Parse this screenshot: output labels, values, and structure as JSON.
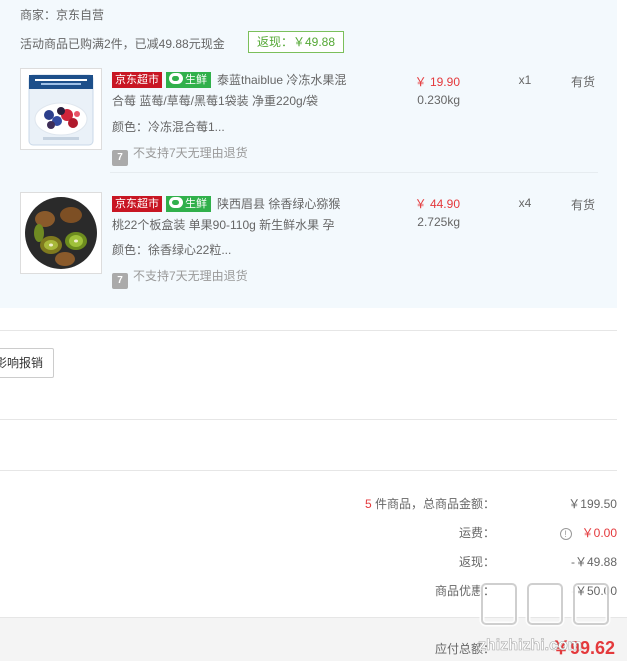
{
  "order": {
    "seller": "商家：京东自营",
    "promo_text": "活动商品已购满2件，已减49.88元现金",
    "rebate_tag": "返现：￥49.88"
  },
  "items": [
    {
      "badge_jd": "京东超市",
      "badge_fresh": "生鲜",
      "title": "泰蓝thaiblue 冷冻水果混合莓 蓝莓/草莓/黑莓1袋装 净重220g/袋",
      "color": "颜色：冷冻混合莓1...",
      "return_policy": "不支持7天无理由退货",
      "return_icon": "7",
      "price": "￥ 19.90",
      "weight": "0.230kg",
      "qty": "x1",
      "stock": "有货"
    },
    {
      "badge_jd": "京东超市",
      "badge_fresh": "生鲜",
      "title": "陕西眉县 徐香绿心猕猴桃22个板盒装 单果90-110g 新生鲜水果 孕",
      "color": "颜色：徐香绿心22粒...",
      "return_policy": "不支持7天无理由退货",
      "return_icon": "7",
      "price": "￥ 44.90",
      "weight": "2.725kg",
      "qty": "x4",
      "stock": "有货"
    }
  ],
  "side_button": "影响报销",
  "summary": {
    "count": "5",
    "count_label": "件商品，总商品金额：",
    "goods_total": "￥199.50",
    "shipping_label": "运费：",
    "shipping_value": "￥0.00",
    "rebate_label": "返现：",
    "rebate_value": "-￥49.88",
    "discount_label": "商品优惠：",
    "discount_value": "-￥50.00",
    "total_label": "应付总额：",
    "total_value": "￥99.62"
  },
  "watermark": {
    "text": "zhizhizhi.com"
  },
  "colors": {
    "accent_red": "#e4393c",
    "jd_red": "#c81623",
    "fresh_green": "#30b04b",
    "rebate_green": "#54a835",
    "panel_bg": "#f3f9fd"
  },
  "icons": [
    "fresh-leaf-icon",
    "return-7day-icon",
    "info-icon"
  ]
}
